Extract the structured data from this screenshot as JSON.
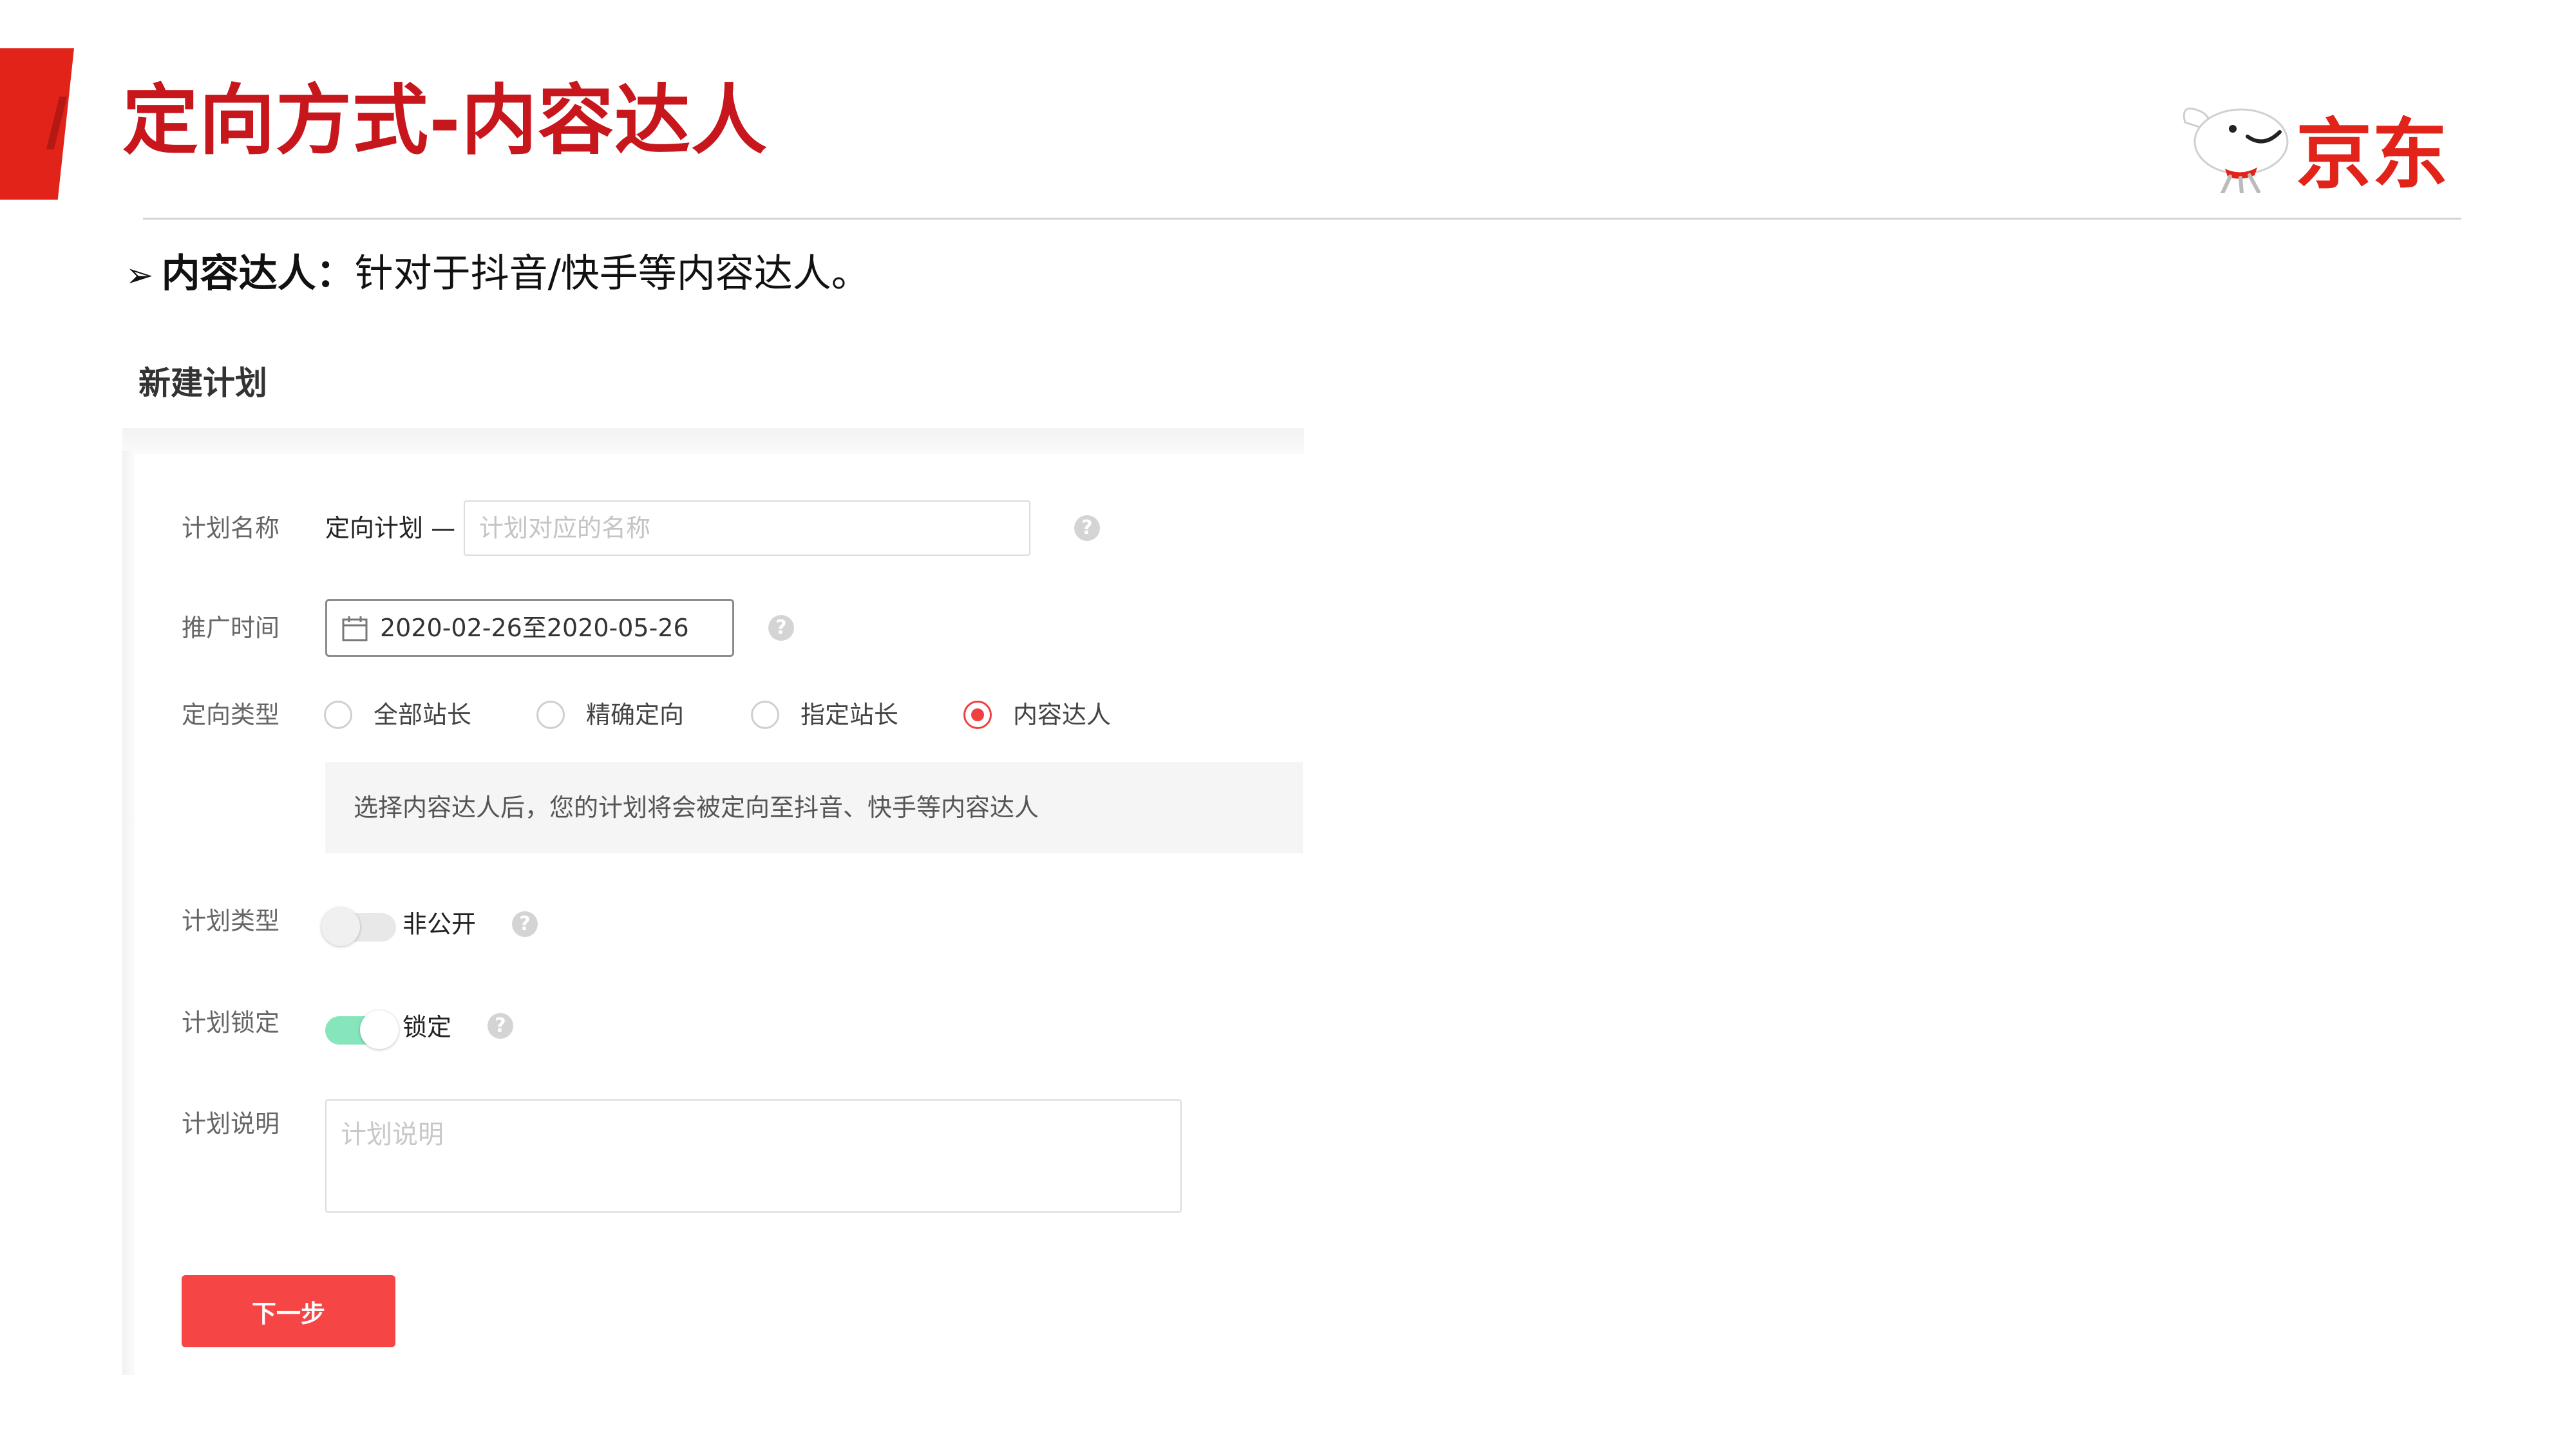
{
  "slide": {
    "title": "定向方式-内容达人",
    "logo_text": "京东",
    "bullet": {
      "marker": "➢",
      "term": "内容达人",
      "colon": "：",
      "description": "针对于抖音/快手等内容达人。"
    }
  },
  "form": {
    "heading": "新建计划",
    "plan_name": {
      "label": "计划名称",
      "prefix": "定向计划 —",
      "placeholder": "计划对应的名称",
      "value": ""
    },
    "promo_time": {
      "label": "推广时间",
      "value": "2020-02-26至2020-05-26"
    },
    "targeting_type": {
      "label": "定向类型",
      "options": [
        "全部站长",
        "精确定向",
        "指定站长",
        "内容达人"
      ],
      "selected": "内容达人",
      "tip": "选择内容达人后，您的计划将会被定向至抖音、快手等内容达人"
    },
    "plan_type": {
      "label": "计划类型",
      "switch_on": false,
      "switch_text": "非公开"
    },
    "plan_lock": {
      "label": "计划锁定",
      "switch_on": true,
      "switch_text": "锁定"
    },
    "plan_desc": {
      "label": "计划说明",
      "placeholder": "计划说明",
      "value": ""
    },
    "help_symbol": "?",
    "next_button": "下一步"
  },
  "colors": {
    "brand_red": "#e2231a",
    "title_red": "#c8161d",
    "button_red": "#f54545",
    "radio_selected": "#f04040",
    "switch_on": "#86e5bb"
  }
}
